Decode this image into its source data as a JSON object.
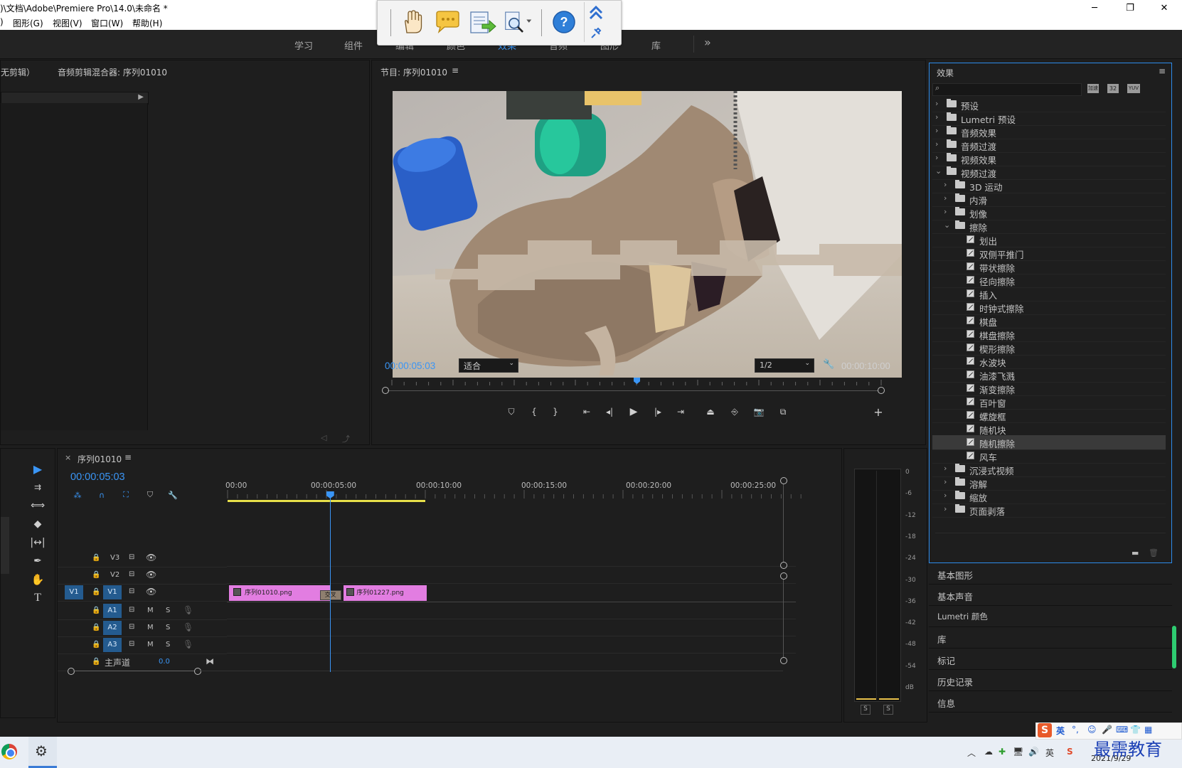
{
  "window": {
    "title": ")\\文档\\Adobe\\Premiere Pro\\14.0\\未命名 *",
    "controls": {
      "minimize": "─",
      "maximize": "❐",
      "close": "✕"
    }
  },
  "menu": {
    "items": [
      ")",
      "图形(G)",
      "视图(V)",
      "窗口(W)",
      "帮助(H)"
    ]
  },
  "workspaces": {
    "items": [
      "学习",
      "组件",
      "编辑",
      "颜色",
      "效果",
      "音频",
      "图形",
      "库"
    ],
    "more": "»",
    "active_index": 4
  },
  "left_panel": {
    "tab1": "无剪辑）",
    "tab2": "音频剪辑混合器: 序列01010"
  },
  "program_monitor": {
    "title": "节目: 序列01010",
    "menu_icon": "≡",
    "timecode": "00:00:05:03",
    "fit": "适合",
    "resolution": "1/2",
    "duration": "00:00:10:00",
    "playhead_fraction": 0.5
  },
  "timeline": {
    "tab": "序列01010",
    "close": "×",
    "menu": "≡",
    "timecode": "00:00:05:03",
    "ruler": [
      "00:00",
      "00:00:05:00",
      "00:00:10:00",
      "00:00:15:00",
      "00:00:20:00",
      "00:00:25:00"
    ],
    "tracks": [
      {
        "name": "V3",
        "source": ""
      },
      {
        "name": "V2",
        "source": ""
      },
      {
        "name": "V1",
        "source": "V1"
      },
      {
        "name": "A1",
        "m": "M",
        "s": "S"
      },
      {
        "name": "A2",
        "m": "M",
        "s": "S"
      },
      {
        "name": "A3",
        "m": "M",
        "s": "S"
      }
    ],
    "master": {
      "label": "主声道",
      "value": "0.0"
    },
    "clips": [
      {
        "name": "序列01010.png",
        "start": 0,
        "end": 5.1
      },
      {
        "name": "序列01227.png",
        "start": 5.8,
        "end": 10.0
      }
    ],
    "transition": "交叉"
  },
  "audio_meter": {
    "scale": [
      "0",
      "-6",
      "-12",
      "-18",
      "-24",
      "-30",
      "-36",
      "-42",
      "-48",
      "-54",
      "dB"
    ],
    "solo": [
      "S",
      "S"
    ]
  },
  "effects": {
    "title": "效果",
    "menu": "≡",
    "search_placeholder": "",
    "toolbar": [
      "加速",
      "32",
      "YUV"
    ],
    "tree": [
      {
        "label": "预设",
        "level": 0,
        "type": "folder-star",
        "open": false
      },
      {
        "label": "Lumetri 预设",
        "level": 0,
        "type": "folder-star",
        "open": false
      },
      {
        "label": "音频效果",
        "level": 0,
        "type": "folder",
        "open": false
      },
      {
        "label": "音频过渡",
        "level": 0,
        "type": "folder",
        "open": false
      },
      {
        "label": "视频效果",
        "level": 0,
        "type": "folder",
        "open": false
      },
      {
        "label": "视频过渡",
        "level": 0,
        "type": "folder",
        "open": true
      },
      {
        "label": "3D 运动",
        "level": 1,
        "type": "folder",
        "open": false
      },
      {
        "label": "内滑",
        "level": 1,
        "type": "folder",
        "open": false
      },
      {
        "label": "划像",
        "level": 1,
        "type": "folder",
        "open": false
      },
      {
        "label": "擦除",
        "level": 1,
        "type": "folder",
        "open": true
      },
      {
        "label": "划出",
        "level": 2,
        "type": "fx"
      },
      {
        "label": "双侧平推门",
        "level": 2,
        "type": "fx"
      },
      {
        "label": "带状擦除",
        "level": 2,
        "type": "fx"
      },
      {
        "label": "径向擦除",
        "level": 2,
        "type": "fx"
      },
      {
        "label": "插入",
        "level": 2,
        "type": "fx"
      },
      {
        "label": "时钟式擦除",
        "level": 2,
        "type": "fx"
      },
      {
        "label": "棋盘",
        "level": 2,
        "type": "fx"
      },
      {
        "label": "棋盘擦除",
        "level": 2,
        "type": "fx"
      },
      {
        "label": "楔形擦除",
        "level": 2,
        "type": "fx"
      },
      {
        "label": "水波块",
        "level": 2,
        "type": "fx"
      },
      {
        "label": "油漆飞溅",
        "level": 2,
        "type": "fx"
      },
      {
        "label": "渐变擦除",
        "level": 2,
        "type": "fx"
      },
      {
        "label": "百叶窗",
        "level": 2,
        "type": "fx"
      },
      {
        "label": "螺旋框",
        "level": 2,
        "type": "fx"
      },
      {
        "label": "随机块",
        "level": 2,
        "type": "fx"
      },
      {
        "label": "随机擦除",
        "level": 2,
        "type": "fx",
        "selected": true
      },
      {
        "label": "风车",
        "level": 2,
        "type": "fx"
      },
      {
        "label": "沉浸式视频",
        "level": 1,
        "type": "folder",
        "open": false
      },
      {
        "label": "溶解",
        "level": 1,
        "type": "folder",
        "open": false
      },
      {
        "label": "缩放",
        "level": 1,
        "type": "folder",
        "open": false
      },
      {
        "label": "页面剥落",
        "level": 1,
        "type": "folder",
        "open": false
      }
    ]
  },
  "side_panels": [
    "基本图形",
    "基本声音",
    "Lumetri 颜色",
    "库",
    "标记",
    "历史记录",
    "信息"
  ],
  "taskbar": {
    "date": "2021/9/29",
    "ime": "英",
    "tray_text": "英",
    "watermark": "最需教育"
  },
  "colors": {
    "accent": "#2d8ceb",
    "clip": "#e27de1",
    "timecode": "#3a95f5"
  }
}
